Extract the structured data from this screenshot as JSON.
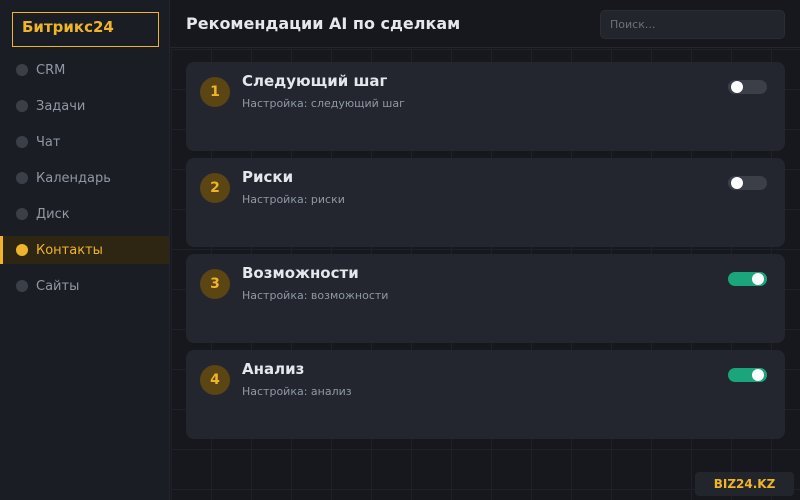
{
  "app": {
    "logo": "Битрикс24"
  },
  "sidebar": {
    "items": [
      {
        "label": "CRM",
        "active": false
      },
      {
        "label": "Задачи",
        "active": false
      },
      {
        "label": "Чат",
        "active": false
      },
      {
        "label": "Календарь",
        "active": false
      },
      {
        "label": "Диск",
        "active": false
      },
      {
        "label": "Контакты",
        "active": true
      },
      {
        "label": "Сайты",
        "active": false
      }
    ]
  },
  "header": {
    "title": "Рекомендации AI по сделкам",
    "search_placeholder": "Поиск..."
  },
  "cards": [
    {
      "number": "1",
      "title": "Следующий шаг",
      "subtitle": "Настройка: следующий шаг",
      "enabled": false
    },
    {
      "number": "2",
      "title": "Риски",
      "subtitle": "Настройка: риски",
      "enabled": false
    },
    {
      "number": "3",
      "title": "Возможности",
      "subtitle": "Настройка: возможности",
      "enabled": true
    },
    {
      "number": "4",
      "title": "Анализ",
      "subtitle": "Настройка: анализ",
      "enabled": true
    }
  ],
  "footer": {
    "brand": "BIZ24.KZ"
  },
  "colors": {
    "accent": "#f0b429",
    "toggle_on": "#1aa57a",
    "toggle_off": "#3b3f47"
  }
}
